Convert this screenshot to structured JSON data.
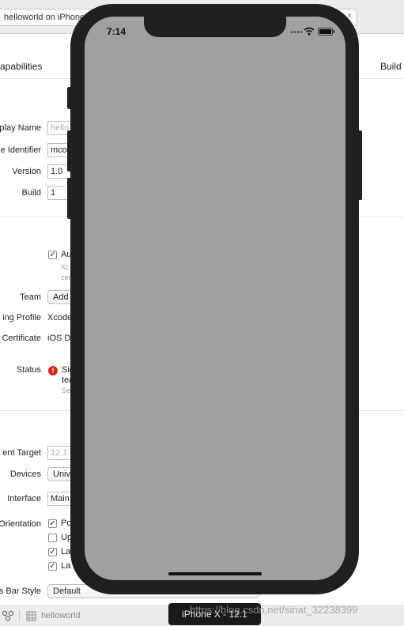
{
  "xcode": {
    "window_tab": {
      "title": "helloworld on iPhone",
      "close": "×"
    },
    "subtabs": {
      "capabilities": "apabilities",
      "build": "Build"
    },
    "identity": {
      "display_name_label": "play Name",
      "display_name_value": "hello",
      "bundle_id_label": "e Identifier",
      "bundle_id_value": "mco",
      "version_label": "Version",
      "version_value": "1.0",
      "build_label": "Build",
      "build_value": "1"
    },
    "signing": {
      "auto_checkbox": "✓",
      "auto_label": "Au",
      "auto_sub_1": "Xc",
      "auto_sub_2": "cer",
      "team_label": "Team",
      "team_button": "Add",
      "profile_label": "ing Profile",
      "profile_value": "Xcode",
      "certificate_label": "Certificate",
      "certificate_value": "iOS D",
      "status_label": "Status",
      "status_icon": "!",
      "status_line_1": "Sig",
      "status_line_2": "tea",
      "status_line_3": "Se"
    },
    "deployment": {
      "target_label": "ent Target",
      "target_value": "12.1",
      "devices_label": "Devices",
      "devices_value": "Univ",
      "interface_label": "Interface",
      "interface_value": "Main",
      "orientation_label": "Orientation",
      "orientations": [
        {
          "mark": "✓",
          "label": "Po"
        },
        {
          "mark": "",
          "label": "Up"
        },
        {
          "mark": "✓",
          "label": "La"
        },
        {
          "mark": "✓",
          "label": "La"
        }
      ],
      "status_bar_label": "s Bar Style",
      "status_bar_value": "Default"
    },
    "bottom_bar": {
      "project": "helloworld"
    }
  },
  "simulator": {
    "time": "7:14",
    "caption": "iPhone X - 12.1",
    "icons": [
      "cellular-dots-icon",
      "wifi-icon",
      "battery-icon"
    ]
  },
  "watermark": "https://blog.csdn.net/sinat_32238399"
}
